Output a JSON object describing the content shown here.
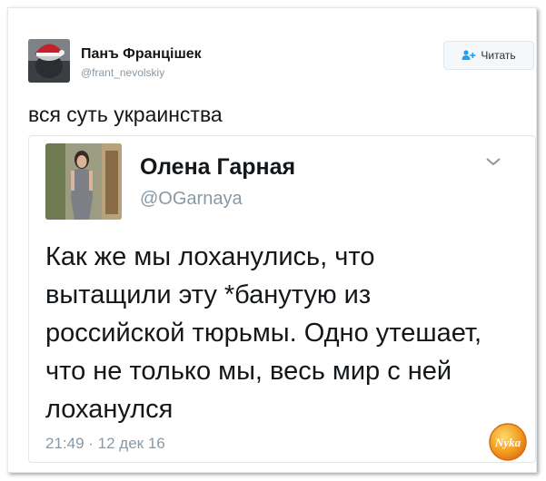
{
  "outer_tweet": {
    "author_name": "Панъ Францішек",
    "author_handle": "@frant_nevolskiy",
    "follow_button_label": "Читать",
    "text": "вся суть украинства"
  },
  "quoted_tweet": {
    "author_name": "Олена Гарная",
    "author_handle": "@OGarnaya",
    "text_lines": [
      "Как же мы лоханулись, что",
      "вытащили эту *банутую из",
      "российской тюрьмы. Одно утешает,",
      "что не только мы, весь мир с ней",
      "лоханулся"
    ],
    "timestamp": "21:49 · 12 дек 16"
  },
  "watermark": {
    "text": "Nyka"
  },
  "colors": {
    "text": "#14171a",
    "muted": "#8899a6",
    "border": "#e1e8ed",
    "follow_icon": "#1da1f2"
  },
  "icons": {
    "follow": "follow-person-icon",
    "menu": "chevron-down-icon"
  }
}
